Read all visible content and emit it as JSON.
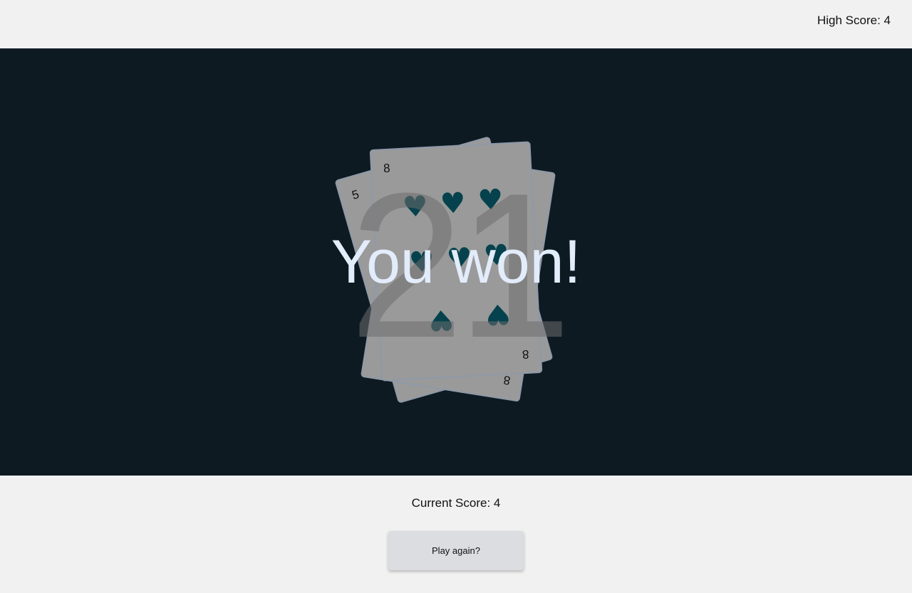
{
  "header": {
    "high_score": "High Score: 4"
  },
  "game": {
    "total": "21",
    "result_message": "You won!",
    "cards": [
      {
        "rank": "5",
        "suit": "spades"
      },
      {
        "rank": "8",
        "suit": "spades"
      },
      {
        "rank": "8",
        "suit": "hearts"
      }
    ],
    "pip_hearts": "♥",
    "pip_spades": "♠"
  },
  "footer": {
    "current_score": "Current Score: 4",
    "play_again_label": "Play again?"
  },
  "colors": {
    "board": "#0d1a22",
    "pip": "#05424d",
    "card": "#9a9a9a",
    "message": "#e3ecfb"
  }
}
